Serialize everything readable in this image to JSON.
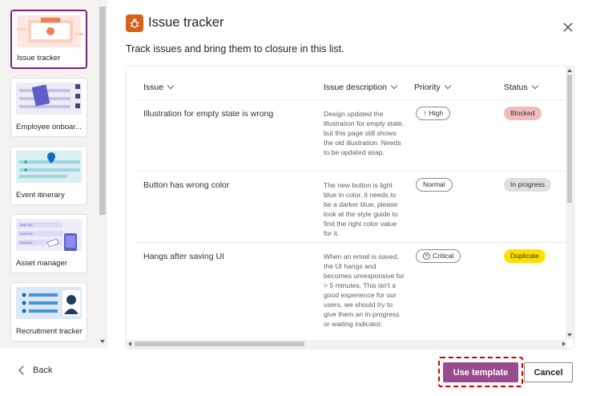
{
  "panel": {
    "title": "Issue tracker",
    "subtitle": "Track issues and bring them to closure in this list."
  },
  "templates": [
    {
      "label": "Issue tracker",
      "selected": true
    },
    {
      "label": "Employee onboar..."
    },
    {
      "label": "Event itinerary"
    },
    {
      "label": "Asset manager"
    },
    {
      "label": "Recruitment tracker"
    }
  ],
  "asset_card_text": [
    "5687786",
    "5695796",
    "5564512"
  ],
  "table": {
    "columns": [
      "Issue",
      "Issue description",
      "Priority",
      "Status"
    ],
    "rows": [
      {
        "issue": "Illustration for empty state is wrong",
        "description": "Design updated the illustration for empty state, but this page still shows the old illustration. Needs to be updated asap.",
        "priority": "High",
        "priority_icon": "arrow-up-icon",
        "status": "Blocked",
        "status_color": "#f1bbbc"
      },
      {
        "issue": "Button has wrong color",
        "description": "The new button is light blue in color, it needs to be a darker blue, please look at the style guide to find the right color value for it.",
        "priority": "Normal",
        "priority_icon": "",
        "status": "In progress",
        "status_color": "#e1dfdd"
      },
      {
        "issue": "Hangs after saving UI",
        "description": "When an email is saved, the UI hangs and becomes unresponsive for > 5 minutes. This isn't a good experience for our users, we should try to give them an in-progress or waiting indicator.",
        "priority": "Critical",
        "priority_icon": "x-circle-icon",
        "status": "Duplicate",
        "status_color": "#fce100"
      }
    ]
  },
  "footer": {
    "back_label": "Back",
    "use_template_label": "Use template",
    "cancel_label": "Cancel"
  },
  "colors": {
    "accent": "#9b4a8f",
    "selected_border": "#742774",
    "header_icon": "#d4621a"
  }
}
